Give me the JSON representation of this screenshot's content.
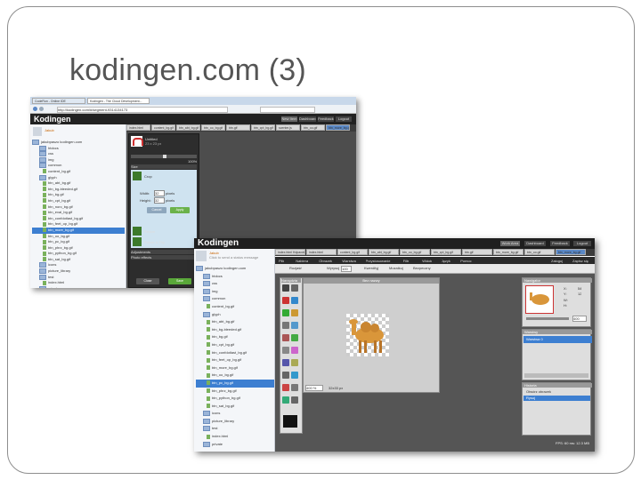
{
  "slide": {
    "title": "kodingen.com (3)"
  },
  "shot1": {
    "address": "http://kodingen.com/#/segment-9314134173",
    "browser_tabs": [
      "CodeRun - Online IDE",
      "Kodingen - The Cloud Development..."
    ],
    "brand": "Kodingen",
    "top_buttons": [
      "New Item",
      "Dashboard",
      "Feedback",
      "Logout"
    ],
    "user": "Jakub",
    "tree": [
      "jakubpaszo kodingen.com",
      "htdocs",
      "css",
      "img",
      "common",
      "content_bg.gif",
      "glyph",
      "btn_abt_bg.gif",
      "btn_bg-bleeded.gif",
      "btn_bg.gif",
      "btn_cpt_bg.gif",
      "btn_norc_bg.gif",
      "btn_eval_bg.gif",
      "btn_confdotlast_bg.gif",
      "btn_feet_op_bg.gif",
      "btn_more_bg.gif",
      "btn_oo_bg.gif",
      "btn_pc_bg.gif",
      "btn_phrz_bg.gif",
      "btn_python_bg.gif",
      "btn_sat_bg.gif",
      "icons",
      "picture_library",
      "test",
      "index.html",
      "private"
    ],
    "file_tabs": [
      "index.html",
      "content_bg.gif",
      "btn_abt_bg.gif",
      "btn_oo_bg.gif",
      "btn.gif",
      "btn_cpt_bg.gif",
      "scenter.js",
      "btn_oo.gif",
      "btn_more_bg.gif"
    ],
    "panel": {
      "doc_title": "Untitled",
      "doc_size": "23 x 23 px",
      "zoom": "100%",
      "section": "Size",
      "tool_crop": "Crop",
      "width_label": "Width:",
      "width_val": "32",
      "height_label": "Height:",
      "height_val": "32",
      "unit": "pixels",
      "cancel": "Cancel",
      "apply": "Apply",
      "tool_resize": "Resize",
      "tool_rotate": "Rotate & Flip",
      "adjustments": "Adjustments",
      "photo_effects": "Photo effects",
      "close": "Close",
      "save": "Save"
    }
  },
  "shot2": {
    "brand": "Kodingen",
    "top_buttons": [
      "Work Area",
      "Dashboard",
      "Feedback",
      "Logout"
    ],
    "user": "Jakub",
    "user_sub": "Click to send a status message",
    "tree": [
      "jakubpaszo kodingen.com",
      "htdocs",
      "css",
      "img",
      "common",
      "content_bg.gif",
      "glyph",
      "btn_abt_bg.gif",
      "btn_bg-bleeded.gif",
      "btn_bg.gif",
      "btn_cpt_bg.gif",
      "btn_confdotlast_bg.gif",
      "btn_feet_op_bg.gif",
      "btn_more_bg.gif",
      "btn_oo_bg.gif",
      "btn_pc_bg.gif",
      "btn_phrz_bg.gif",
      "btn_python_bg.gif",
      "btn_sat_bg.gif",
      "icons",
      "picture_library",
      "test",
      "index.html",
      "private"
    ],
    "file_tabs": [
      "index.html Hdpaxdsexvo",
      "index.html",
      "content_bg.gif",
      "btn_abt_bg.gif",
      "btn_oo_bg.gif",
      "btn_cpt_bg.gif",
      "btn.gif",
      "btn_more_bg.gif",
      "btn_oo.gif",
      "btn_more_bg.gif"
    ],
    "menu": [
      "Plik",
      "Nabiera",
      "Obrazek",
      "Warstwa",
      "Przystosowanie",
      "Filtr",
      "Widok",
      "Język",
      "Pomoc"
    ],
    "menu_right": [
      "Zaloguj",
      "Zapisz się"
    ],
    "toolbar": {
      "label1": "Rozjaśń",
      "label2": "Wyrysuj",
      "val": "100",
      "opt1": "Kwerdityj",
      "opt2": "Mozaikuj",
      "opt3": "Bezpeczny"
    },
    "toolbox_title": "Narzędzia",
    "canvas_title": "Bez nazwy",
    "zoom": "400 %",
    "size_readout": "32x33 px",
    "navigator": {
      "title": "Nawigator",
      "x_label": "X:",
      "x": "54",
      "y_label": "Y:",
      "y": "12",
      "w_label": "W:",
      "h_label": "H:",
      "zoom": "400"
    },
    "layers": {
      "title": "Warstwy",
      "item": "Warstwa 0"
    },
    "history": {
      "title": "Historia",
      "items": [
        "Otwórz obrazek",
        "Rysuj"
      ]
    },
    "footer": "FPS: 60   ms: 12.3 MB"
  }
}
